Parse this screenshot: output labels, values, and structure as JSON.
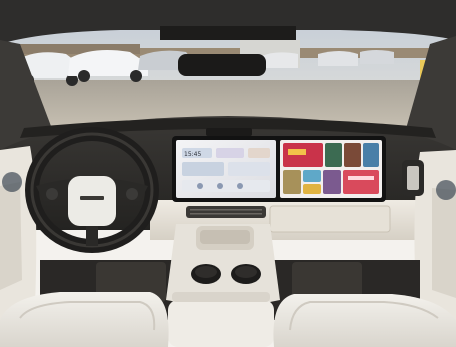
{
  "photo": {
    "subject": "car-interior-dashboard",
    "colors": {
      "sky": "#cfd6de",
      "lot": "#b7b1a6",
      "headliner": "#2e2d2c",
      "dash_dark": "#2f2d2b",
      "dash_light": "#e8e3d9",
      "seat": "#ece9e3",
      "screen_bezel": "#151515",
      "media_red": "#c9334a"
    }
  },
  "left_screen": {
    "clock": "15:45"
  }
}
